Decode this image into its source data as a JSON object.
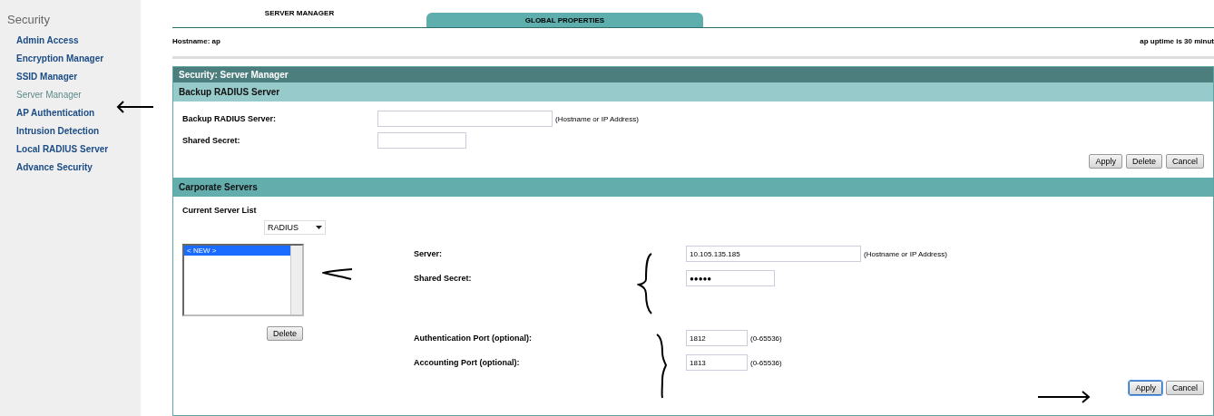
{
  "sidebar": {
    "title": "Security",
    "items": [
      {
        "label": "Admin Access",
        "selected": false
      },
      {
        "label": "Encryption Manager",
        "selected": false
      },
      {
        "label": "SSID Manager",
        "selected": false
      },
      {
        "label": "Server Manager",
        "selected": true
      },
      {
        "label": "AP Authentication",
        "selected": false
      },
      {
        "label": "Intrusion Detection",
        "selected": false
      },
      {
        "label": "Local RADIUS Server",
        "selected": false
      },
      {
        "label": "Advance Security",
        "selected": false
      }
    ]
  },
  "tabs": [
    {
      "label": "SERVER MANAGER",
      "selected": true
    },
    {
      "label": "GLOBAL PROPERTIES",
      "selected": false
    }
  ],
  "hostname": "Hostname: ap",
  "uptime": "ap uptime is 30 minut",
  "panel_title": "Security: Server Manager",
  "backup": {
    "title": "Backup RADIUS Server",
    "fields": [
      {
        "label": "Backup RADIUS Server:",
        "hint": "(Hostname or IP Address)"
      },
      {
        "label": "Shared Secret:"
      }
    ],
    "buttons": [
      {
        "label": "Apply",
        "focused": false
      },
      {
        "label": "Delete",
        "focused": false
      },
      {
        "label": "Cancel",
        "focused": false
      }
    ]
  },
  "corporate": {
    "title": "Carporate Servers",
    "list_label": "Current Server List",
    "protocol": "RADIUS",
    "servers": [
      {
        "label": "< NEW >",
        "selected": true
      }
    ],
    "delete_button": "Delete",
    "fields": [
      {
        "label": "Server:",
        "value": "10.105.135.185",
        "hint": "(Hostname or IP Address)"
      },
      {
        "label": "Shared Secret:",
        "value": "●●●●●"
      },
      {
        "label": "Authentication Port (optional):",
        "value": "1812",
        "hint": "(0-65536)"
      },
      {
        "label": "Accounting Port (optional):",
        "value": "1813",
        "hint": "(0-65536)"
      }
    ],
    "buttons": [
      {
        "label": "Apply",
        "focused": true
      },
      {
        "label": "Cancel",
        "focused": false
      }
    ]
  }
}
